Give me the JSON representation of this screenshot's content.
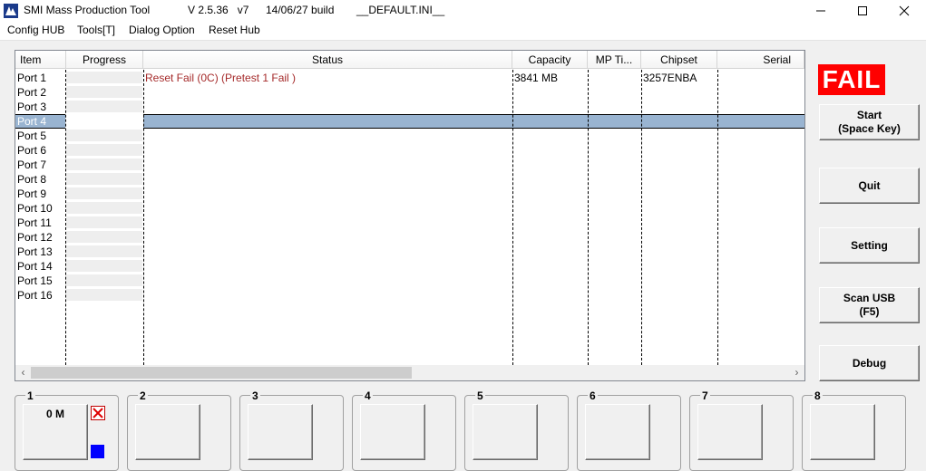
{
  "window": {
    "app_name": "SMI Mass Production Tool",
    "version": "V 2.5.36   v7",
    "build": "14/06/27 build",
    "ini": "__DEFAULT.INI__"
  },
  "menu": [
    "Config HUB",
    "Tools[T]",
    "Dialog Option",
    "Reset Hub"
  ],
  "grid": {
    "columns": [
      "Item",
      "Progress",
      "Status",
      "Capacity",
      "MP Ti...",
      "Chipset",
      "Serial"
    ],
    "rows": [
      {
        "item": "Port 1",
        "status": "Reset Fail (0C) (Pretest 1 Fail )",
        "capacity": "3841 MB",
        "chipset": "3257ENBA"
      },
      {
        "item": "Port 2"
      },
      {
        "item": "Port 3"
      },
      {
        "item": "Port 4",
        "selected": true
      },
      {
        "item": "Port 5"
      },
      {
        "item": "Port 6"
      },
      {
        "item": "Port 7"
      },
      {
        "item": "Port 8"
      },
      {
        "item": "Port 9"
      },
      {
        "item": "Port 10"
      },
      {
        "item": "Port 11"
      },
      {
        "item": "Port 12"
      },
      {
        "item": "Port 13"
      },
      {
        "item": "Port 14"
      },
      {
        "item": "Port 15"
      },
      {
        "item": "Port 16"
      }
    ]
  },
  "result": "FAIL",
  "buttons": {
    "start": "Start\n(Space Key)",
    "quit": "Quit",
    "setting": "Setting",
    "scan": "Scan USB\n(F5)",
    "debug": "Debug"
  },
  "ports": [
    {
      "num": "1",
      "capacity": "0 M"
    },
    {
      "num": "2",
      "capacity": ""
    },
    {
      "num": "3",
      "capacity": ""
    },
    {
      "num": "4",
      "capacity": ""
    },
    {
      "num": "5",
      "capacity": ""
    },
    {
      "num": "6",
      "capacity": ""
    },
    {
      "num": "7",
      "capacity": ""
    },
    {
      "num": "8",
      "capacity": ""
    }
  ],
  "colors": {
    "fail": "#ff0000",
    "status_text": "#a52a2a",
    "selection": "#99b4d1",
    "port_indicator": "#0000ff"
  },
  "icons": [
    "app-icon",
    "minimize-icon",
    "maximize-icon",
    "close-icon",
    "fail-x-icon"
  ]
}
